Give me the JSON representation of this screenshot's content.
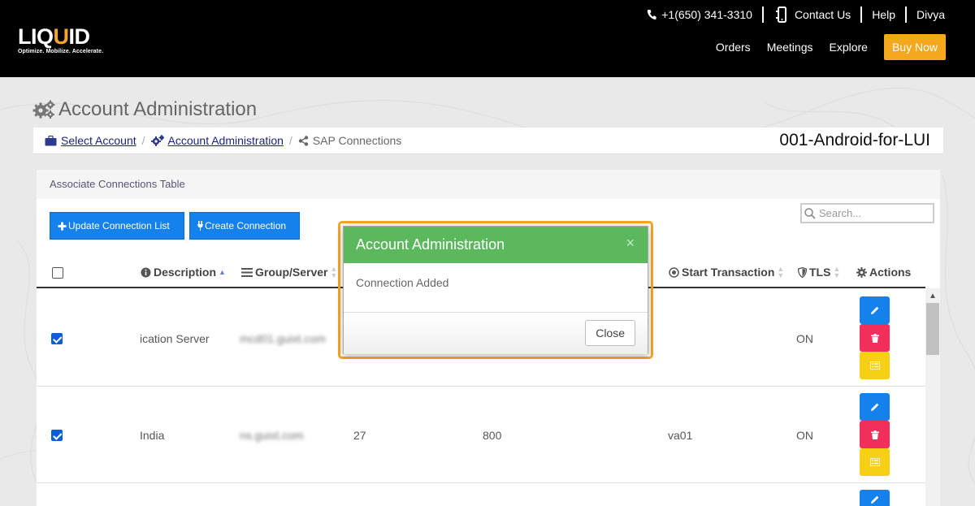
{
  "header": {
    "logo_word_pre": "LIQ",
    "logo_word_u": "U",
    "logo_word_post": "ID",
    "logo_tagline": "Optimize. Mobilize. Accelerate.",
    "phone": "+1(650) 341-3310",
    "contact": "Contact Us",
    "help": "Help",
    "user": "Divya",
    "nav": [
      "Orders",
      "Meetings",
      "Explore"
    ],
    "buy_now": "Buy Now"
  },
  "page": {
    "title": "Account Administration",
    "breadcrumb": {
      "select_account": "Select Account",
      "account_admin": "Account Administration",
      "current": "SAP Connections",
      "account_code": "001-Android-for-LUI"
    }
  },
  "panel": {
    "title": "Associate Connections Table",
    "update_button": "Update Connection List",
    "create_button": "Create Connection",
    "search_placeholder": "Search...",
    "columns": {
      "description": "Description",
      "group_server": "Group/Server",
      "start_transaction": "Start Transaction",
      "tls": "TLS",
      "actions": "Actions"
    },
    "rows": [
      {
        "description": "ication Server",
        "server": "mcd01.guixt.com",
        "c3": "",
        "c4": "",
        "start_transaction": "",
        "tls": "ON"
      },
      {
        "description": "India",
        "server": "ns.guixt.com",
        "c3": "27",
        "c4": "800",
        "start_transaction": "va01",
        "tls": "ON"
      }
    ]
  },
  "modal": {
    "title": "Account Administration",
    "close_x": "×",
    "message": "Connection Added",
    "close_button": "Close"
  },
  "colors": {
    "header_bg": "#000000",
    "accent_orange": "#f5a81c",
    "primary_blue": "#1581ec",
    "danger_red": "#f12f5a",
    "warning_yellow": "#f7cf14",
    "modal_green": "#5cb85c"
  }
}
